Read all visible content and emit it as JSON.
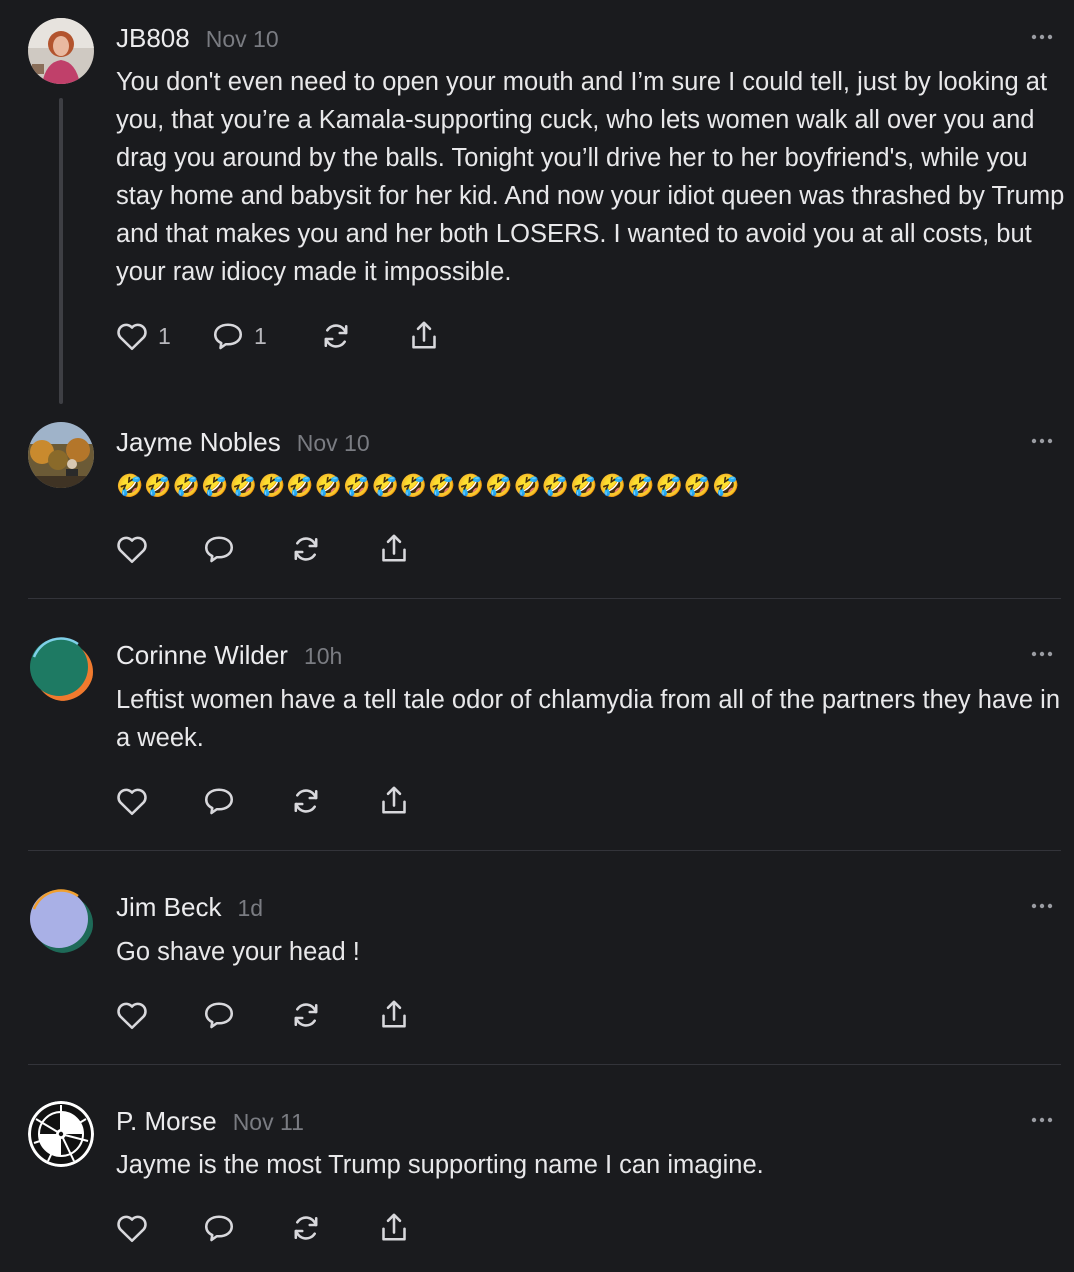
{
  "comments": [
    {
      "name": "JB808",
      "time": "Nov 10",
      "text": "You don't even need to open your mouth and I’m sure I could tell, just by looking at you, that you’re a Kamala-supporting cuck, who lets women walk all over you and drag you around by the balls. Tonight you’ll drive her to her boyfriend's, while you stay home and babysit for her kid. And now your idiot queen was thrashed by Trump and that makes you and her both LOSERS. I wanted to avoid you at all costs, but your raw idiocy made it impossible.",
      "like_count": "1",
      "reply_count": "1"
    },
    {
      "name": "Jayme Nobles",
      "time": "Nov 10",
      "text": "🤣🤣🤣🤣🤣🤣🤣🤣🤣🤣🤣🤣🤣🤣🤣🤣🤣🤣🤣🤣🤣🤣"
    },
    {
      "name": "Corinne Wilder",
      "time": "10h",
      "text": "Leftist women have a tell tale odor of chlamydia from all of the partners they have in a week."
    },
    {
      "name": "Jim Beck",
      "time": "1d",
      "text": "Go shave your head !"
    },
    {
      "name": "P. Morse",
      "time": "Nov 11",
      "text": "Jayme is the most Trump supporting name I can imagine."
    }
  ],
  "icons": {
    "like": "heart-icon",
    "reply": "speech-bubble-icon",
    "restack": "restack-arrows-icon",
    "share": "share-upload-icon",
    "more": "ellipsis-icon"
  },
  "colors": {
    "background": "#1a1b1e",
    "text": "#e8e8ea",
    "muted": "#7a7c82",
    "divider": "#33343a"
  }
}
